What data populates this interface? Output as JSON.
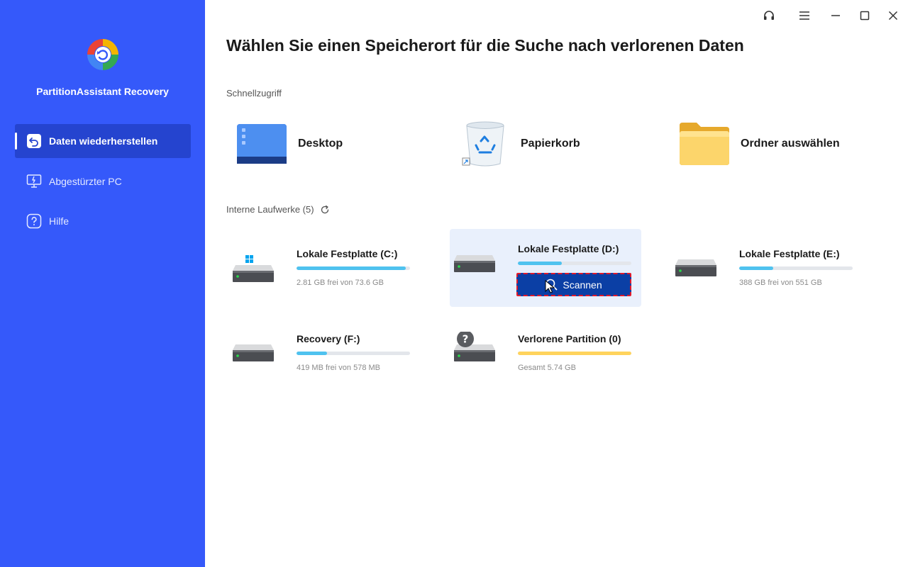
{
  "app": {
    "name": "PartitionAssistant Recovery",
    "accent_color": "#3559fa",
    "active_nav_color": "#2544cf",
    "scan_button_color": "#0b3fa5"
  },
  "sidebar": {
    "items": [
      {
        "label": "Daten wiederherstellen",
        "icon": "restore-icon",
        "active": true
      },
      {
        "label": "Abgestürzter PC",
        "icon": "crashed-pc-icon",
        "active": false
      },
      {
        "label": "Hilfe",
        "icon": "help-icon",
        "active": false
      }
    ]
  },
  "window_controls": [
    "support-headset-icon",
    "menu-icon",
    "minimize-icon",
    "maximize-icon",
    "close-icon"
  ],
  "main": {
    "title": "Wählen Sie einen Speicherort für die Suche nach verlorenen Daten",
    "quick_access": {
      "label": "Schnellzugriff",
      "items": [
        {
          "label": "Desktop",
          "icon": "desktop-icon"
        },
        {
          "label": "Papierkorb",
          "icon": "recycle-bin-icon"
        },
        {
          "label": "Ordner auswählen",
          "icon": "folder-icon"
        }
      ]
    },
    "drives_section": {
      "label": "Interne Laufwerke (5)",
      "refresh_icon": "refresh-icon"
    },
    "drives": [
      {
        "name": "Lokale Festplatte (C:)",
        "info": "2.81 GB frei von 73.6 GB",
        "used_fraction": 0.96,
        "color": "#4fc2ef"
      },
      {
        "name": "Lokale Festplatte (D:)",
        "info": "",
        "used_fraction": 0.39,
        "color": "#4fc2ef",
        "selected": true,
        "scan_label": "Scannen"
      },
      {
        "name": "Lokale Festplatte (E:)",
        "info": "388 GB frei von 551 GB",
        "used_fraction": 0.3,
        "color": "#4fc2ef"
      },
      {
        "name": "Recovery (F:)",
        "info": "419 MB frei von 578 MB",
        "used_fraction": 0.27,
        "color": "#4fc2ef"
      },
      {
        "name": "Verlorene Partition (0)",
        "info": "Gesamt 5.74 GB",
        "used_fraction": 1.0,
        "color": "#ffd35c"
      }
    ]
  }
}
